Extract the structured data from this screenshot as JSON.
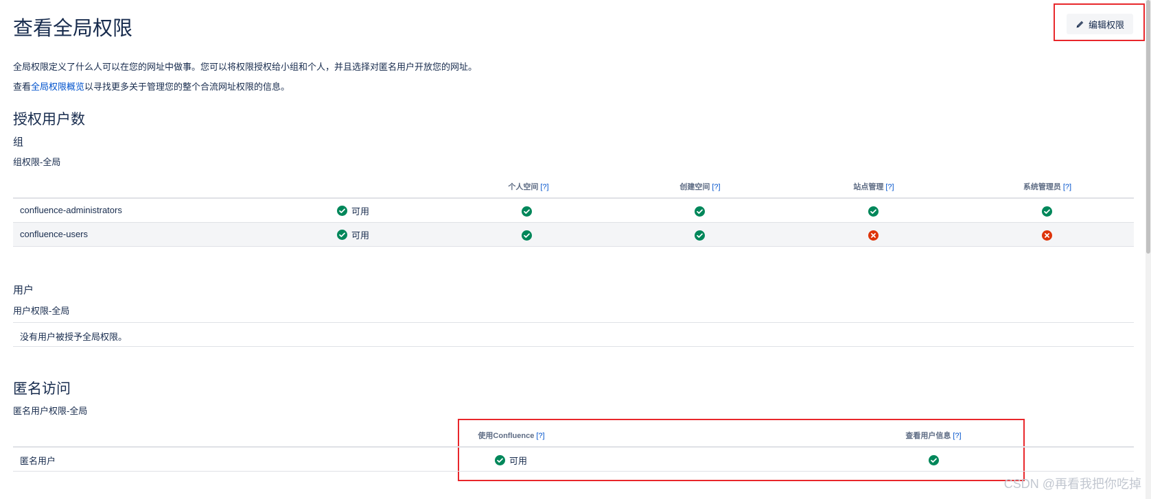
{
  "page_title": "查看全局权限",
  "edit_button_label": "编辑权限",
  "intro": {
    "line1": "全局权限定义了什么人可以在您的网址中做事。您可以将权限授权给小组和个人，并且选择对匿名用户开放您的网址。",
    "line2_prefix": "查看",
    "line2_link": "全局权限概览",
    "line2_suffix": "以寻找更多关于管理您的整个合流网址权限的信息。"
  },
  "licensed_users_heading": "授权用户数",
  "groups": {
    "heading": "组",
    "subheading": "组权限-全局",
    "columns": [
      "个人空间",
      "创建空间",
      "站点管理",
      "系统管理员"
    ],
    "help_marker": "[?]",
    "rows": [
      {
        "name": "confluence-administrators",
        "available_label": "可用",
        "perms": [
          "check",
          "check",
          "check",
          "check"
        ]
      },
      {
        "name": "confluence-users",
        "available_label": "可用",
        "perms": [
          "check",
          "check",
          "cross",
          "cross"
        ]
      }
    ]
  },
  "users": {
    "heading": "用户",
    "subheading": "用户权限-全局",
    "empty_text": "没有用户被授予全局权限。"
  },
  "anonymous": {
    "heading": "匿名访问",
    "subheading": "匿名用户权限-全局",
    "columns": [
      "使用Confluence",
      "查看用户信息"
    ],
    "row_label": "匿名用户",
    "available_label": "可用"
  },
  "watermark": "CSDN @再看我把你吃掉",
  "colors": {
    "check": "#00875a",
    "cross": "#de350b",
    "highlight": "#e8262a",
    "link": "#0052cc"
  }
}
